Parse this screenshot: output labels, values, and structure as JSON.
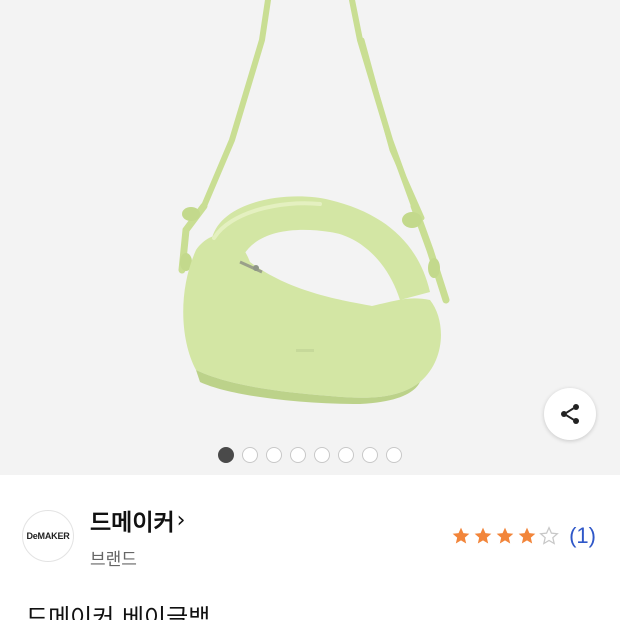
{
  "product": {
    "image_alt": "bag",
    "slides_total": 8,
    "active_slide": 1
  },
  "share": {
    "icon": "share-icon"
  },
  "brand": {
    "logo_text": "DeMAKER",
    "name": "드메이커",
    "chevron": "›",
    "subtitle": "브랜드"
  },
  "rating": {
    "score": 4,
    "max": 5,
    "review_count_text": "(1)",
    "star_color": "#f2853a",
    "empty_star_color": "#c8c8c8"
  },
  "title": "드메이커 베이글백",
  "colors": {
    "accent_link": "#2f57c8",
    "bag": "#d3e6a4"
  }
}
